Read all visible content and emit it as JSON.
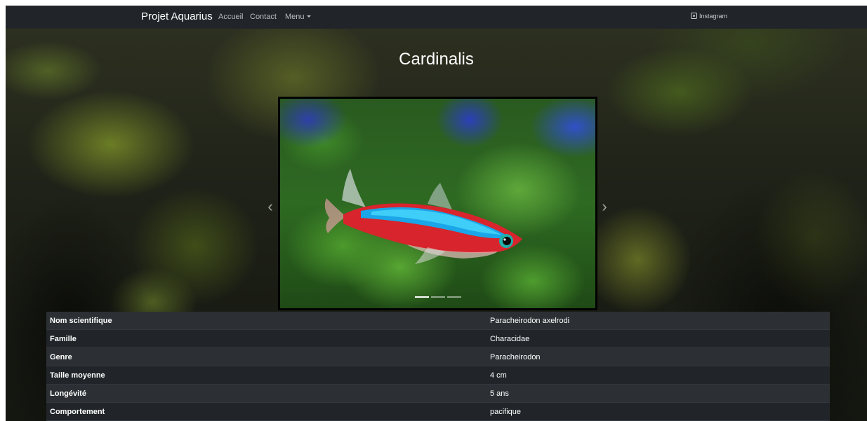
{
  "navbar": {
    "brand": "Projet Aquarius",
    "links": {
      "accueil": "Accueil",
      "contact": "Contact",
      "menu": "Menu"
    },
    "instagram": "Instagram"
  },
  "page": {
    "title": "Cardinalis"
  },
  "carousel": {
    "slide_count": 3,
    "active_slide": 1
  },
  "info": {
    "rows": [
      {
        "label": "Nom scientifique",
        "value": "Paracheirodon axelrodi"
      },
      {
        "label": "Famille",
        "value": "Characidae"
      },
      {
        "label": "Genre",
        "value": "Paracheirodon"
      },
      {
        "label": "Taille moyenne",
        "value": "4 cm"
      },
      {
        "label": "Longévité",
        "value": "5 ans"
      },
      {
        "label": "Comportement",
        "value": "pacifique"
      }
    ]
  },
  "colors": {
    "navbar": "#212529",
    "table_row": "#212529",
    "table_row_alt": "#2c3034",
    "text": "#ffffff",
    "nav_link": "#b9bcbf"
  },
  "icons": {
    "instagram": "instagram-icon",
    "prev": "chevron-left-icon",
    "next": "chevron-right-icon",
    "caret": "caret-down-icon"
  }
}
